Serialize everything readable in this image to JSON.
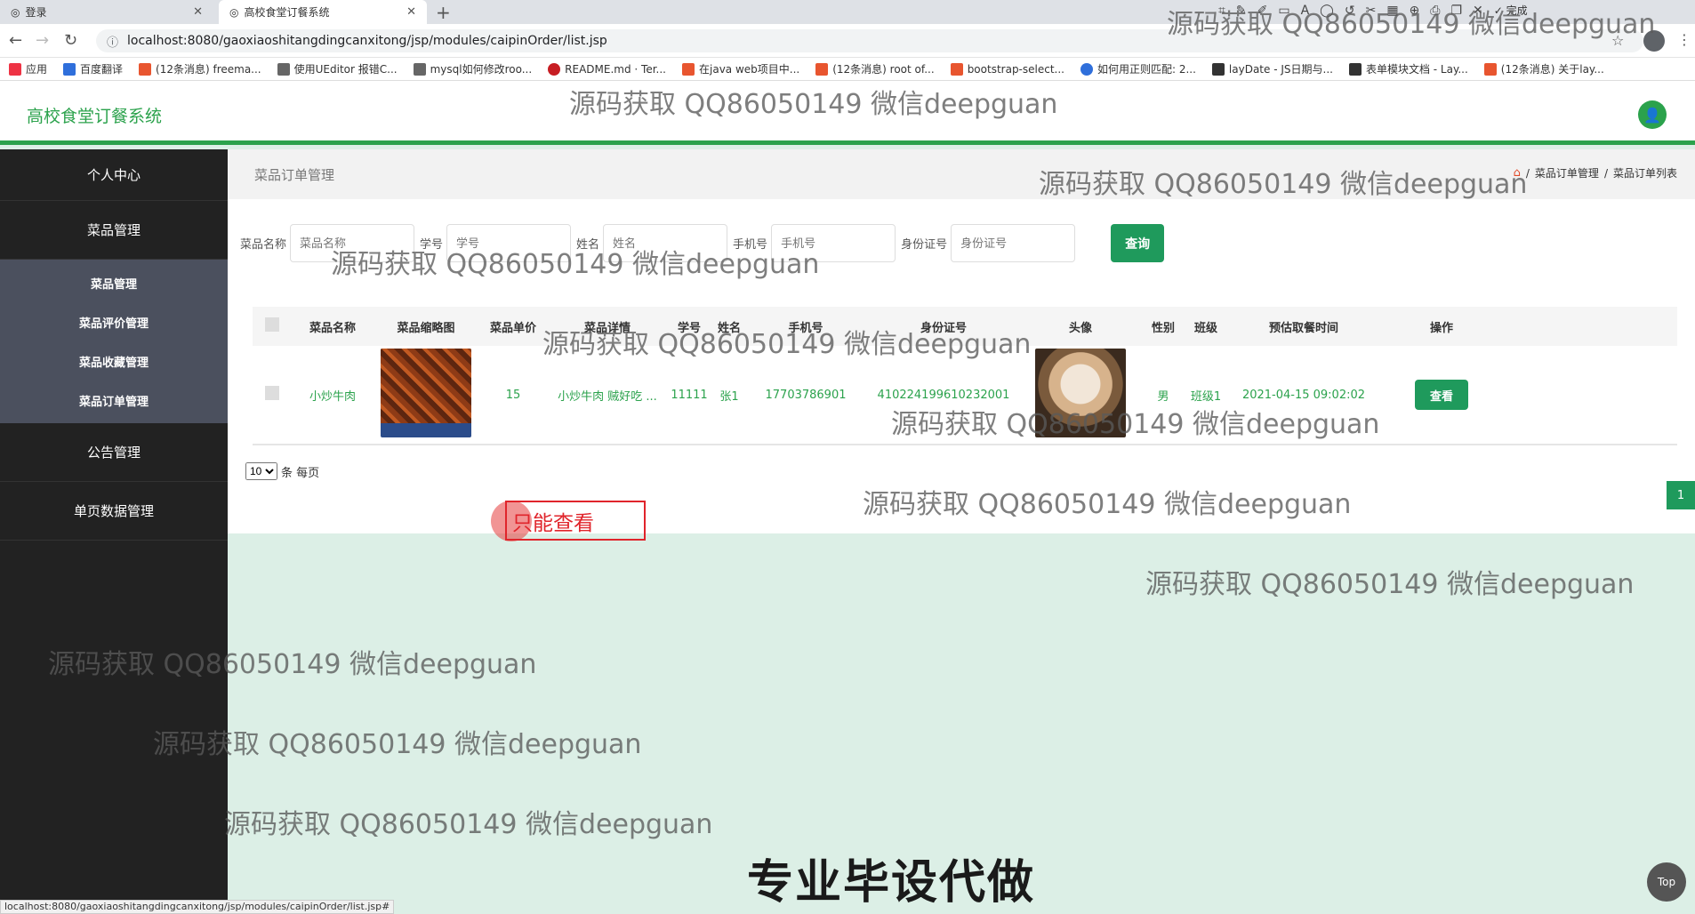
{
  "browser": {
    "tabs": [
      {
        "label": "登录",
        "active": false
      },
      {
        "label": "高校食堂订餐系统",
        "active": true
      }
    ],
    "url": "localhost:8080/gaoxiaoshitangdingcanxitong/jsp/modules/caipinOrder/list.jsp",
    "bookmarks": [
      "应用",
      "百度翻译",
      "(12条消息) freema...",
      "使用UEditor 报错C...",
      "mysql如何修改roo...",
      "README.md · Ter...",
      "在java web项目中...",
      "(12条消息) root of...",
      "bootstrap-select...",
      "如何用正则匹配: 2...",
      "layDate - JS日期与...",
      "表单模块文档 - Lay...",
      "(12条消息) 关于lay..."
    ],
    "annotation_tool": {
      "size": "18",
      "done_label": "完成",
      "main_color": "#f03a3a"
    },
    "status_url": "localhost:8080/gaoxiaoshitangdingcanxitong/jsp/modules/caipinOrder/list.jsp#"
  },
  "app": {
    "title": "高校食堂订餐系统",
    "accent": "#2ba24c"
  },
  "sidebar": {
    "top": "个人中心",
    "group1": "菜品管理",
    "sub_items": [
      "菜品管理",
      "菜品评价管理",
      "菜品收藏管理",
      "菜品订单管理"
    ],
    "group2": "公告管理",
    "group3": "单页数据管理"
  },
  "page": {
    "title": "菜品订单管理",
    "breadcrumb": [
      "菜品订单管理",
      "菜品订单列表"
    ]
  },
  "search": {
    "fields": [
      {
        "label": "菜品名称",
        "placeholder": "菜品名称"
      },
      {
        "label": "学号",
        "placeholder": "学号"
      },
      {
        "label": "姓名",
        "placeholder": "姓名"
      },
      {
        "label": "手机号",
        "placeholder": "手机号"
      },
      {
        "label": "身份证号",
        "placeholder": "身份证号"
      }
    ],
    "button": "查询"
  },
  "table": {
    "headers": [
      "菜品名称",
      "菜品缩略图",
      "菜品单价",
      "菜品详情",
      "学号",
      "姓名",
      "手机号",
      "身份证号",
      "头像",
      "性别",
      "班级",
      "预估取餐时间",
      "操作"
    ],
    "rows": [
      {
        "name": "小炒牛肉",
        "price": "15",
        "detail": "小炒牛肉 贼好吃 ...",
        "student_no": "11111",
        "student_name": "张1",
        "phone": "17703786901",
        "id_card": "410224199610232001",
        "gender": "男",
        "class": "班级1",
        "pickup_time": "2021-04-15 09:02:02",
        "action": "查看"
      }
    ]
  },
  "pager": {
    "page_size": "10",
    "suffix": "条 每页",
    "current_page": "1"
  },
  "overlays": {
    "watermark": "源码获取 QQ86050149 微信deepguan",
    "note": "只能查看",
    "banner": "专业毕设代做",
    "top_button": "Top"
  }
}
